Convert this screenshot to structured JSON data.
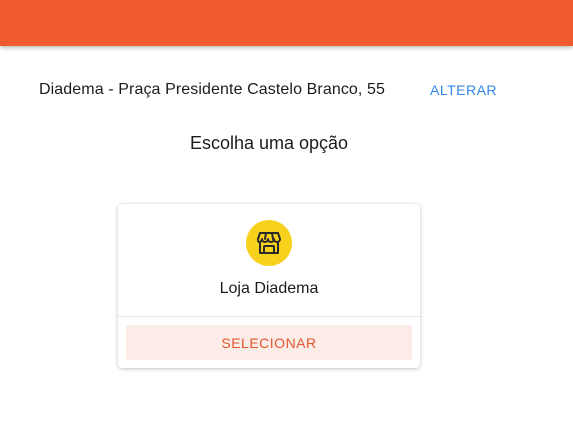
{
  "header": {
    "brand_color": "#f05a2d"
  },
  "location": {
    "address": "Diadema - Praça Presidente Castelo Branco, 55",
    "change_label": "ALTERAR"
  },
  "main": {
    "title": "Escolha uma opção"
  },
  "store_card": {
    "icon": "storefront-icon",
    "icon_bg_color": "#f7d21c",
    "name": "Loja Diadema",
    "select_label": "SELECIONAR"
  }
}
